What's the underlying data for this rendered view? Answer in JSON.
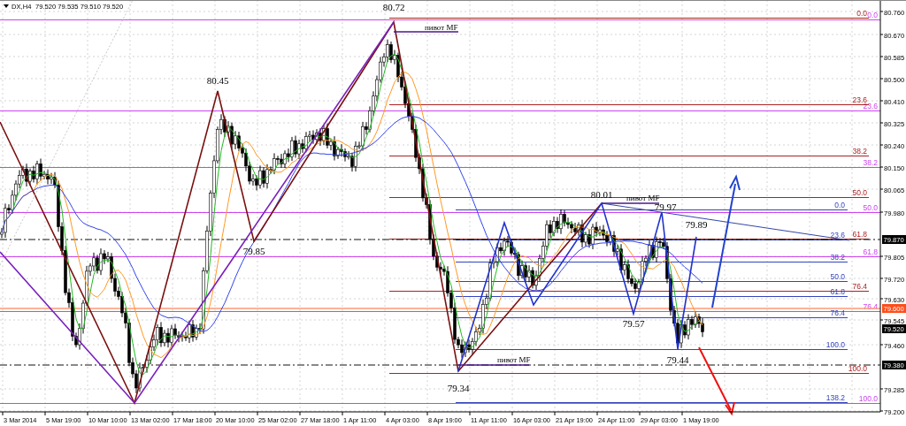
{
  "header": {
    "symbol": "DX,H4",
    "quote": "79.520 79.535 79.510 79.520"
  },
  "price_axis": [
    "80.760",
    "80.670",
    "80.585",
    "80.500",
    "80.410",
    "80.325",
    "80.240",
    "80.150",
    "80.065",
    "79.980",
    "79.805",
    "79.720",
    "79.630",
    "79.545",
    "79.460",
    "79.285",
    "79.200"
  ],
  "price_tags": [
    {
      "label": "79.870",
      "color": "#000000"
    },
    {
      "label": "79.600",
      "color": "#ff4d1a"
    },
    {
      "label": "79.520",
      "color": "#000000"
    },
    {
      "label": "79.380",
      "color": "#000000"
    }
  ],
  "time_axis": [
    "3 Mar 2014",
    "5 Mar 19:00",
    "10 Mar 10:00",
    "13 Mar 02:00",
    "17 Mar 18:00",
    "20 Mar 10:00",
    "25 Mar 02:00",
    "27 Mar 18:00",
    "1 Apr 11:00",
    "4 Apr 03:00",
    "8 Apr 19:00",
    "11 Apr 11:00",
    "16 Apr 03:00",
    "21 Apr 19:00",
    "24 Apr 11:00",
    "29 Apr 03:00",
    "1 May 19:00"
  ],
  "wave_labels": [
    "80.72",
    "80.45",
    "79.85",
    "79.34",
    "80.01",
    "79.97",
    "79.89",
    "79.57",
    "79.44"
  ],
  "pivot_labels": [
    "пивот MF",
    "пивот MF",
    "пивот MF"
  ],
  "fib_sets": [
    {
      "color": "#cc44ee",
      "levels": [
        "0.0",
        "23.6",
        "38.2",
        "50.0",
        "61.8",
        "76.4",
        "100.0"
      ]
    },
    {
      "color": "#aa2222",
      "levels": [
        "0.0",
        "23.6",
        "38.2",
        "50.0",
        "61.8",
        "76.4",
        "100.0"
      ]
    },
    {
      "color": "#3344bb",
      "levels": [
        "0.0",
        "23.6",
        "38.2",
        "50.0",
        "61.8",
        "76.4",
        "100.0",
        "138.2"
      ]
    }
  ]
}
